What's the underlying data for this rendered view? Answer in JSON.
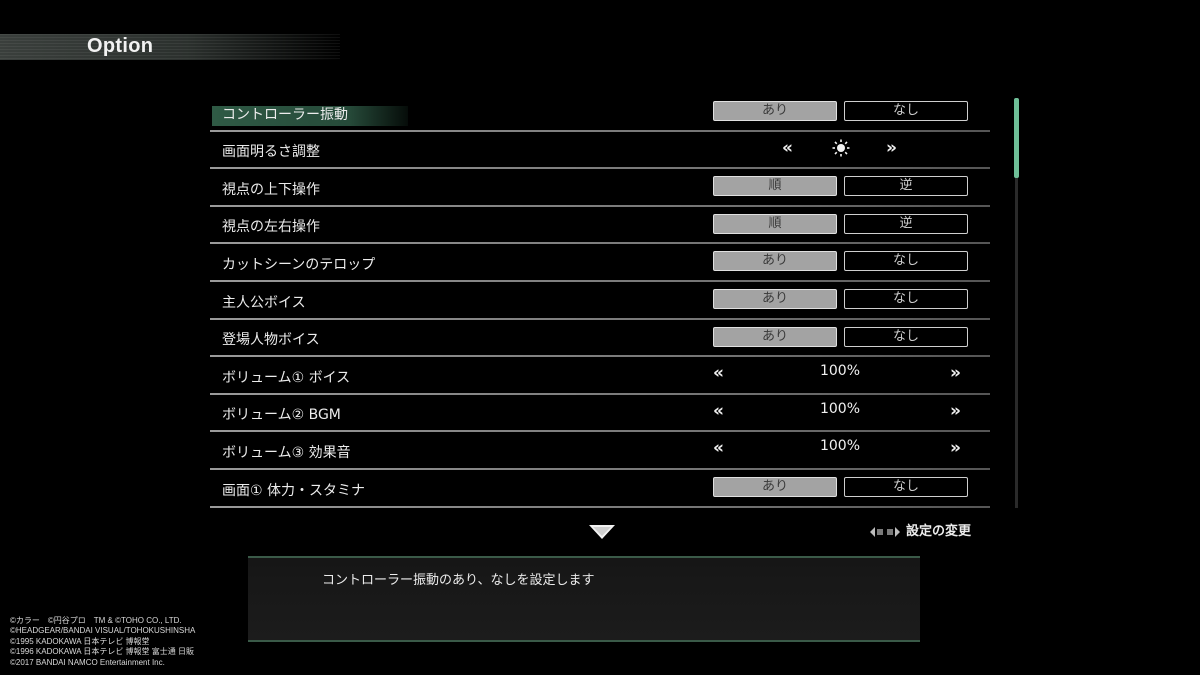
{
  "header": {
    "title": "Option"
  },
  "options": [
    {
      "label": "コントローラー振動",
      "type": "toggle",
      "left": "あり",
      "right": "なし",
      "selected": "left"
    },
    {
      "label": "画面明るさ調整",
      "type": "brightness",
      "left_arrow": "«",
      "right_arrow": "»",
      "icon": "sun-icon"
    },
    {
      "label": "視点の上下操作",
      "type": "toggle",
      "left": "順",
      "right": "逆",
      "selected": "left"
    },
    {
      "label": "視点の左右操作",
      "type": "toggle",
      "left": "順",
      "right": "逆",
      "selected": "left"
    },
    {
      "label": "カットシーンのテロップ",
      "type": "toggle",
      "left": "あり",
      "right": "なし",
      "selected": "left"
    },
    {
      "label": "主人公ボイス",
      "type": "toggle",
      "left": "あり",
      "right": "なし",
      "selected": "left"
    },
    {
      "label": "登場人物ボイス",
      "type": "toggle",
      "left": "あり",
      "right": "なし",
      "selected": "left"
    },
    {
      "label": "ボリューム① ボイス",
      "type": "value",
      "value": "100%",
      "left_arrow": "«",
      "right_arrow": "»"
    },
    {
      "label": "ボリューム② BGM",
      "type": "value",
      "value": "100%",
      "left_arrow": "«",
      "right_arrow": "»"
    },
    {
      "label": "ボリューム③ 効果音",
      "type": "value",
      "value": "100%",
      "left_arrow": "«",
      "right_arrow": "»"
    },
    {
      "label": "画面① 体力・スタミナ",
      "type": "toggle",
      "left": "あり",
      "right": "なし",
      "selected": "left"
    }
  ],
  "hint": {
    "label": "設定の変更"
  },
  "description": "コントローラー振動のあり、なしを設定します",
  "copyright": [
    "©カラー　©円谷プロ　TM & ©TOHO CO., LTD.",
    "©HEADGEAR/BANDAI VISUAL/TOHOKUSHINSHA",
    "©1995 KADOKAWA 日本テレビ 博報堂",
    "©1996 KADOKAWA 日本テレビ 博報堂 富士通 日販",
    "©2017 BANDAI NAMCO Entertainment Inc."
  ],
  "colors": {
    "accent": "#6fbf98",
    "selection": "#2f5a45",
    "active_toggle": "#a3a3a3"
  }
}
